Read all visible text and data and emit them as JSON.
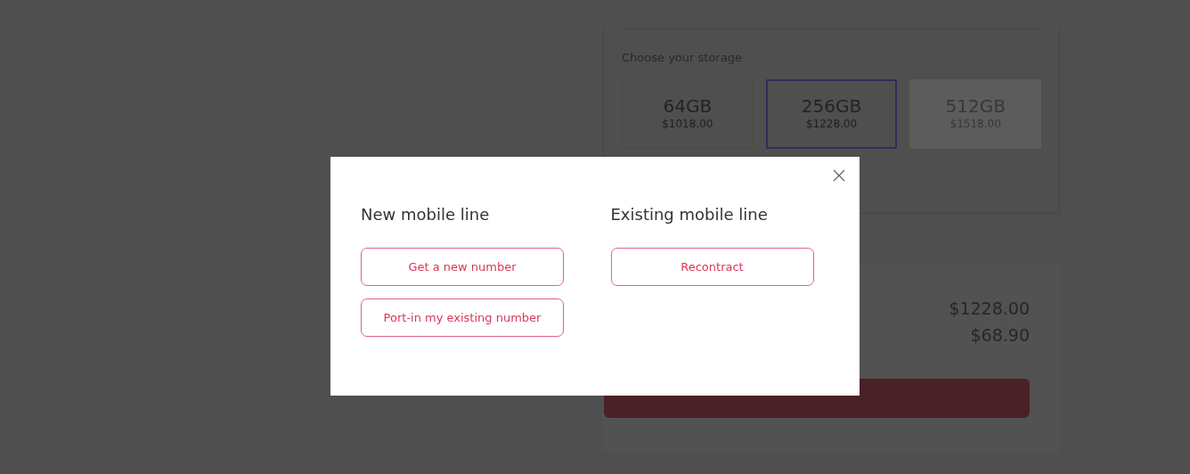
{
  "storage": {
    "label": "Choose your storage",
    "options": [
      {
        "size": "64GB",
        "price": "$1018.00",
        "selected": false,
        "disabled": false
      },
      {
        "size": "256GB",
        "price": "$1228.00",
        "selected": true,
        "disabled": false
      },
      {
        "size": "512GB",
        "price": "$1518.00",
        "selected": false,
        "disabled": true
      }
    ]
  },
  "summary": {
    "prices": [
      "$1228.00",
      "$68.90"
    ]
  },
  "modal": {
    "columns": [
      {
        "title": "New mobile line",
        "buttons": [
          "Get a new number",
          "Port-in my existing number"
        ]
      },
      {
        "title": "Existing mobile line",
        "buttons": [
          "Recontract"
        ]
      }
    ]
  }
}
